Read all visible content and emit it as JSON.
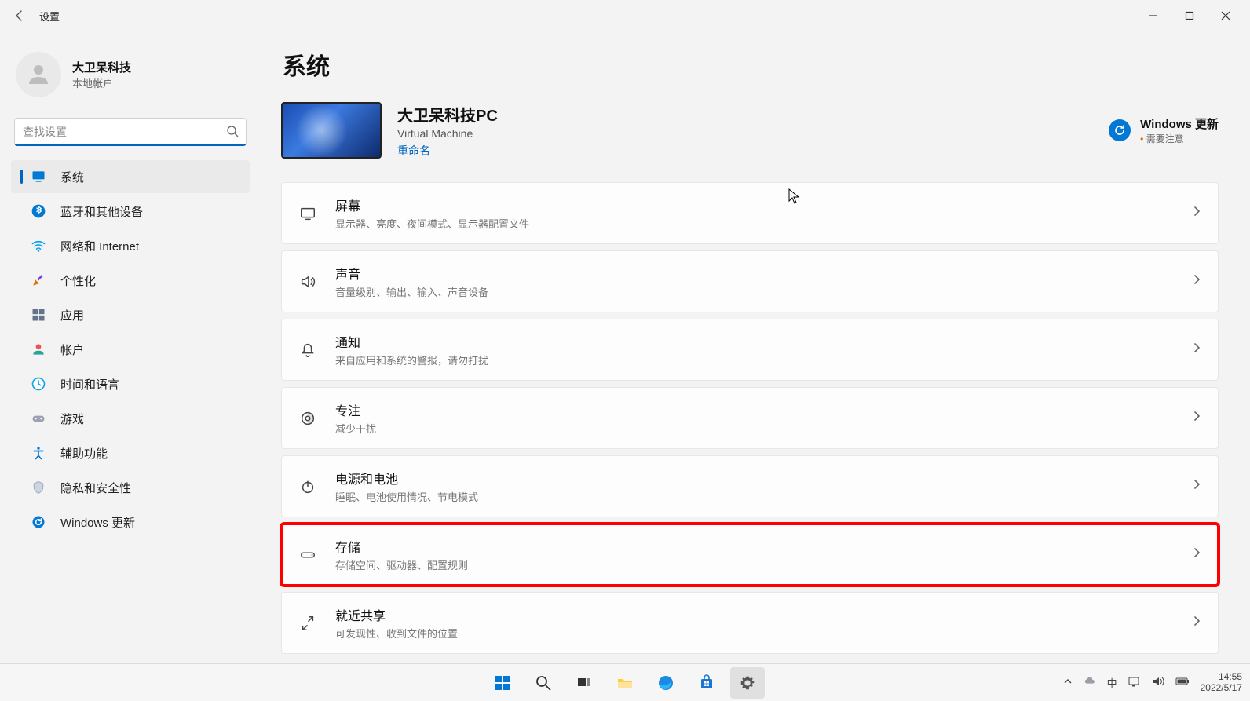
{
  "window": {
    "title": "设置"
  },
  "account": {
    "name": "大卫呆科技",
    "sub": "本地帐户"
  },
  "search": {
    "placeholder": "查找设置"
  },
  "nav": [
    {
      "key": "system",
      "label": "系统",
      "active": true
    },
    {
      "key": "bluetooth",
      "label": "蓝牙和其他设备",
      "active": false
    },
    {
      "key": "network",
      "label": "网络和 Internet",
      "active": false
    },
    {
      "key": "personalize",
      "label": "个性化",
      "active": false
    },
    {
      "key": "apps",
      "label": "应用",
      "active": false
    },
    {
      "key": "accounts",
      "label": "帐户",
      "active": false
    },
    {
      "key": "time",
      "label": "时间和语言",
      "active": false
    },
    {
      "key": "gaming",
      "label": "游戏",
      "active": false
    },
    {
      "key": "accessibility",
      "label": "辅助功能",
      "active": false
    },
    {
      "key": "privacy",
      "label": "隐私和安全性",
      "active": false
    },
    {
      "key": "update",
      "label": "Windows 更新",
      "active": false
    }
  ],
  "page": {
    "title": "系统"
  },
  "device": {
    "name": "大卫呆科技PC",
    "type": "Virtual Machine",
    "rename": "重命名"
  },
  "updates": {
    "title": "Windows 更新",
    "sub": "需要注意"
  },
  "rows": [
    {
      "key": "display",
      "title": "屏幕",
      "desc": "显示器、亮度、夜间模式、显示器配置文件",
      "highlight": false
    },
    {
      "key": "sound",
      "title": "声音",
      "desc": "音量级别、输出、输入、声音设备",
      "highlight": false
    },
    {
      "key": "notify",
      "title": "通知",
      "desc": "来自应用和系统的警报，请勿打扰",
      "highlight": false
    },
    {
      "key": "focus",
      "title": "专注",
      "desc": "减少干扰",
      "highlight": false
    },
    {
      "key": "power",
      "title": "电源和电池",
      "desc": "睡眠、电池使用情况、节电模式",
      "highlight": false
    },
    {
      "key": "storage",
      "title": "存储",
      "desc": "存储空间、驱动器、配置规则",
      "highlight": true
    },
    {
      "key": "nearby",
      "title": "就近共享",
      "desc": "可发现性、收到文件的位置",
      "highlight": false
    }
  ],
  "taskbar": {
    "time": "14:55",
    "date": "2022/5/17",
    "ime": "中"
  }
}
